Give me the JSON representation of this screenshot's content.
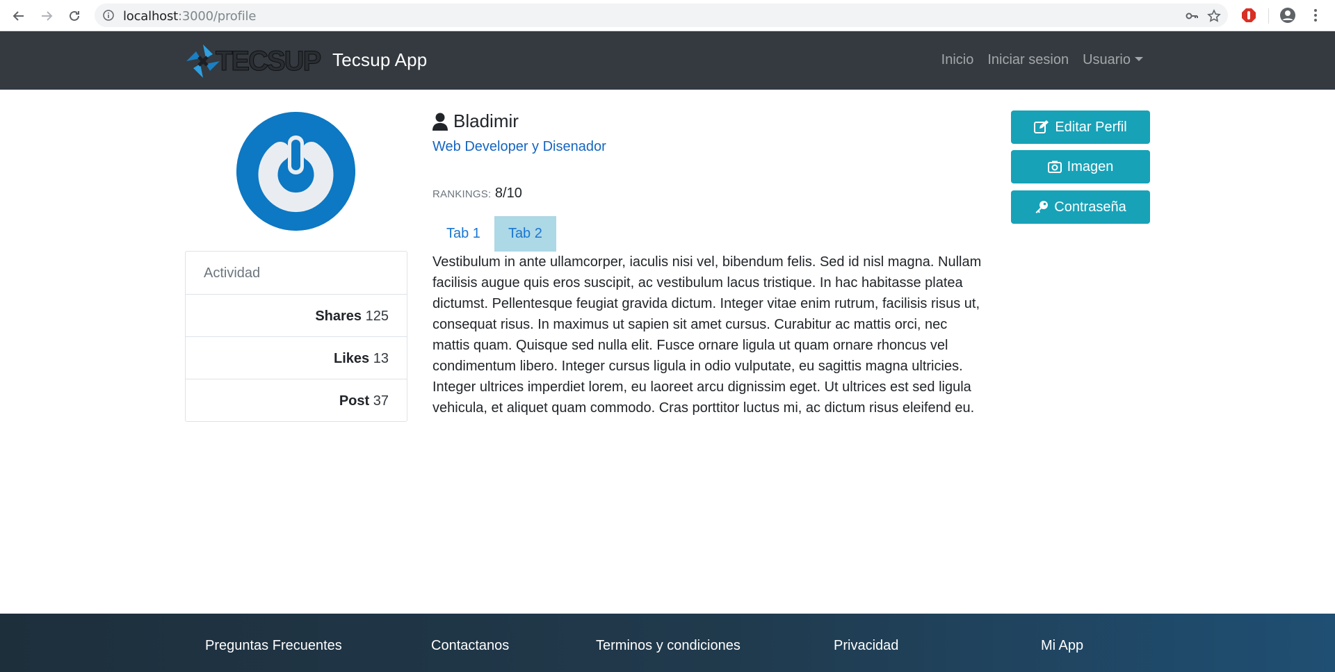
{
  "browser": {
    "url_host": "localhost",
    "url_path": ":3000/profile"
  },
  "navbar": {
    "brand": "Tecsup App",
    "logo_text": "TECSUP",
    "links": [
      "Inicio",
      "Iniciar sesion",
      "Usuario"
    ]
  },
  "profile": {
    "name": "Bladimir",
    "role": "Web Developer y Disenador",
    "rankings_label": "RANKINGS:",
    "rankings_value": "8/10"
  },
  "tabs": {
    "items": [
      "Tab 1",
      "Tab 2"
    ],
    "active": "Tab 2"
  },
  "content": {
    "text": "Vestibulum in ante ullamcorper, iaculis nisi vel, bibendum felis. Sed id nisl magna. Nullam facilisis augue quis eros suscipit, ac vestibulum lacus tristique. In hac habitasse platea dictumst. Pellentesque feugiat gravida dictum. Integer vitae enim rutrum, facilisis risus ut, consequat risus. In maximus ut sapien sit amet cursus. Curabitur ac mattis orci, nec mattis quam. Quisque sed nulla elit. Fusce ornare ligula ut quam ornare rhoncus vel condimentum libero. Integer cursus ligula in odio vulputate, eu sagittis magna ultricies. Integer ultrices imperdiet lorem, eu laoreet arcu dignissim eget. Ut ultrices est sed ligula vehicula, et aliquet quam commodo. Cras porttitor luctus mi, ac dictum risus eleifend eu."
  },
  "activity": {
    "title": "Actividad",
    "stats": [
      {
        "label": "Shares",
        "value": "125"
      },
      {
        "label": "Likes",
        "value": "13"
      },
      {
        "label": "Post",
        "value": "37"
      }
    ]
  },
  "actions": {
    "edit_profile": "Editar Perfil",
    "image": "Imagen",
    "password": "Contraseña"
  },
  "footer": {
    "links": [
      "Preguntas Frecuentes",
      "Contactanos",
      "Terminos y condiciones",
      "Privacidad",
      "Mi App"
    ]
  },
  "colors": {
    "navbar": "#343a40",
    "accent_button": "#17a2b8",
    "link_blue": "#1976d2",
    "active_tab": "#add8e6",
    "avatar_blue": "#0d78c3"
  }
}
